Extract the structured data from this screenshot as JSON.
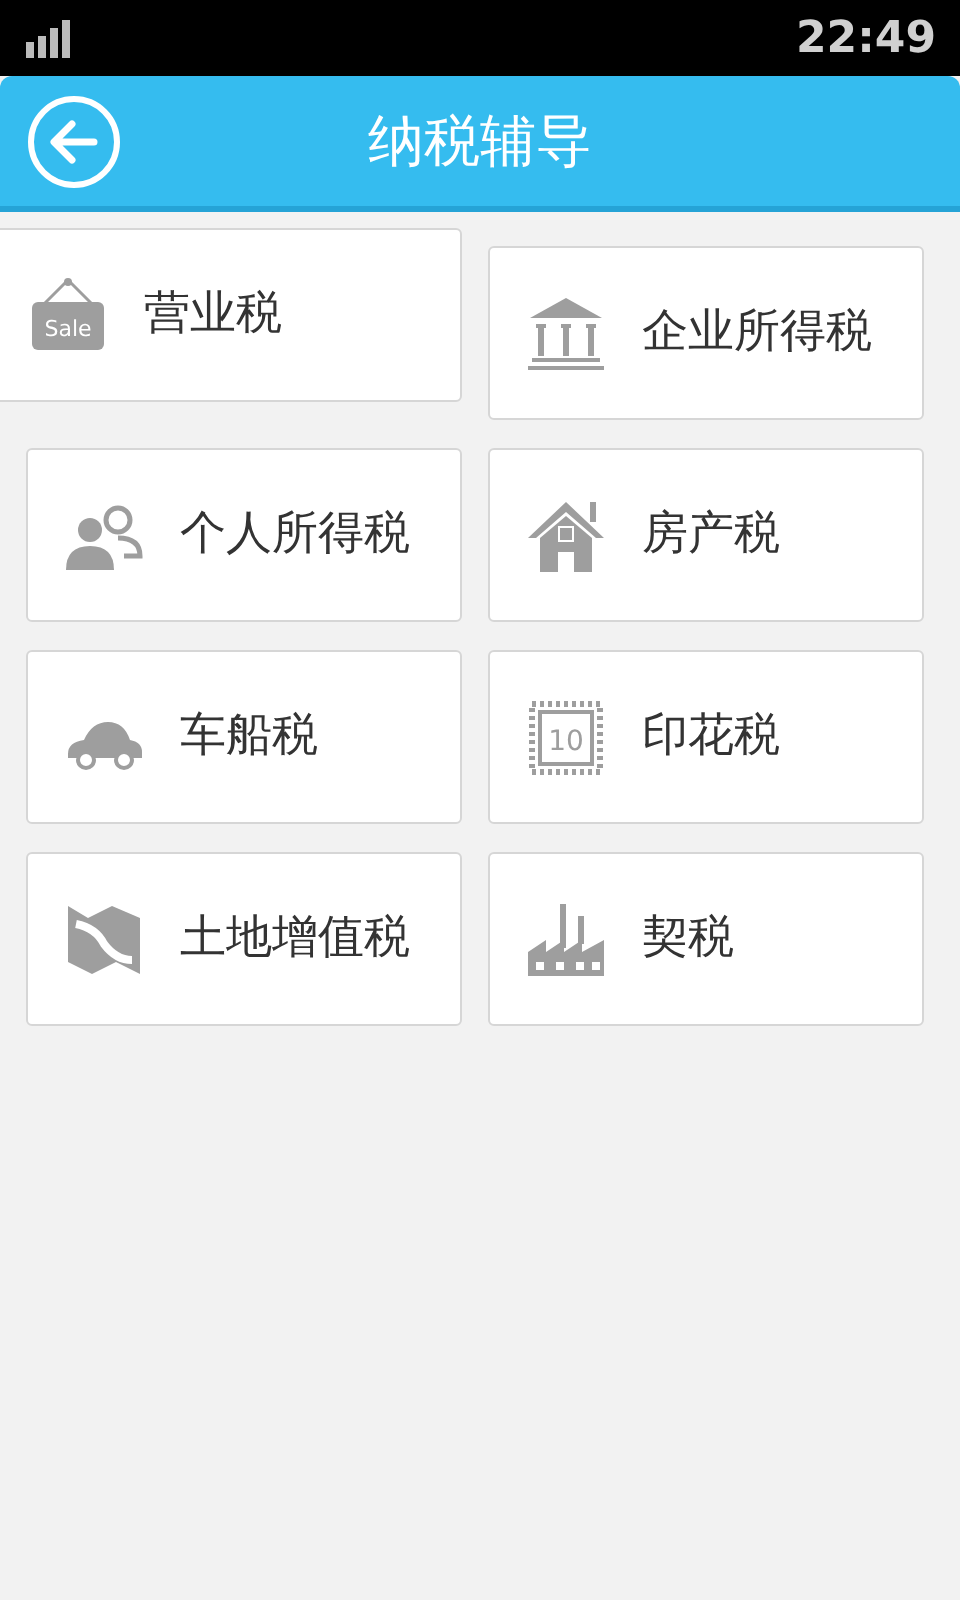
{
  "status_bar": {
    "time": "22:49"
  },
  "header": {
    "title": "纳税辅导"
  },
  "items": [
    {
      "label": "营业税",
      "kind": "sale",
      "icon_text": "Sale"
    },
    {
      "label": "企业所得税",
      "kind": "bank"
    },
    {
      "label": "个人所得税",
      "kind": "people"
    },
    {
      "label": "房产税",
      "kind": "house"
    },
    {
      "label": "车船税",
      "kind": "car"
    },
    {
      "label": "印花税",
      "kind": "stamp",
      "icon_text": "10"
    },
    {
      "label": "土地增值税",
      "kind": "map"
    },
    {
      "label": "契税",
      "kind": "factory"
    }
  ]
}
